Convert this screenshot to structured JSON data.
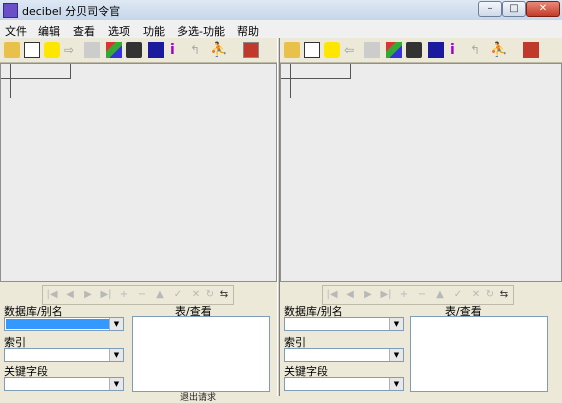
{
  "window": {
    "title": "decibel 分贝司令官",
    "min": "–",
    "max": "□",
    "close": "✕"
  },
  "menu": [
    "文件",
    "编辑",
    "查看",
    "选项",
    "功能",
    "多选-功能",
    "帮助"
  ],
  "toolbar_icons": [
    "open-folder-icon",
    "table-icon",
    "sql-icon",
    "arrow-icon",
    "export-icon",
    "filter-icon",
    "delete-icon",
    "data-icon",
    "info-icon",
    "tool-icon",
    "run-icon",
    "exit-icon"
  ],
  "panes": {
    "left": {
      "db_label": "数据库/别名",
      "index_label": "索引",
      "key_label": "关键字段",
      "table_label": "表/查看"
    },
    "right": {
      "db_label": "数据库/别名",
      "index_label": "索引",
      "key_label": "关键字段",
      "table_label": "表/查看"
    }
  },
  "status": {
    "text": "退出请求"
  },
  "colors": {
    "selection": "#3399ff",
    "toolbar_bg": "#ece9d8"
  }
}
